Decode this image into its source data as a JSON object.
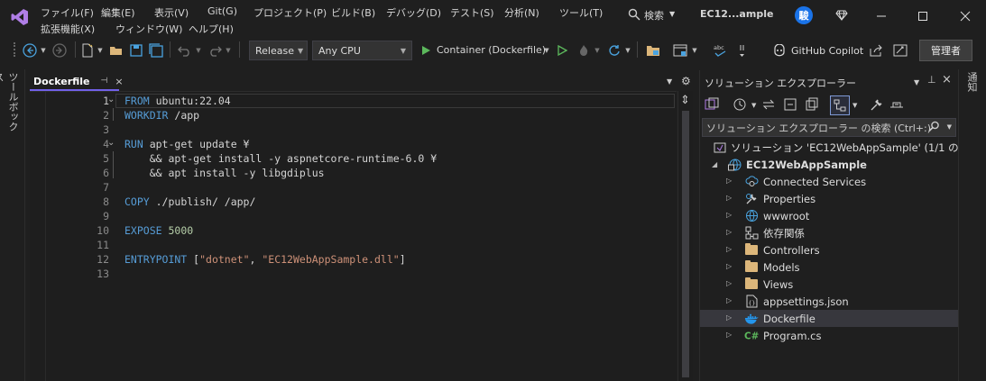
{
  "title_bar": {
    "menu": [
      "ファイル(F)",
      "編集(E)",
      "表示(V)",
      "Git(G)",
      "プロジェクト(P)",
      "ビルド(B)",
      "デバッグ(D)",
      "テスト(S)",
      "分析(N)",
      "ツール(T)"
    ],
    "menu_row2": [
      "拡張機能(X)",
      "ウィンドウ(W)",
      "ヘルプ(H)"
    ],
    "search_label": "検索",
    "window_title": "EC12...ample",
    "avatar_text": "駿"
  },
  "toolbar": {
    "configuration": "Release",
    "platform": "Any CPU",
    "run_target": "Container (Dockerfile)",
    "copilot_label": "GitHub Copilot",
    "admin_label": "管理者"
  },
  "left_rail": {
    "toolbox_label": "ツールボックス"
  },
  "right_rail": {
    "label": "通知"
  },
  "editor": {
    "tab_title": "Dockerfile",
    "line_numbers": [
      "1",
      "2",
      "3",
      "4",
      "5",
      "6",
      "7",
      "8",
      "9",
      "10",
      "11",
      "12",
      "13"
    ],
    "lines": [
      [
        {
          "t": "FROM",
          "c": "kw"
        },
        {
          "t": " ubuntu:22.04",
          "c": "tx"
        }
      ],
      [
        {
          "t": "WORKDIR",
          "c": "kw"
        },
        {
          "t": " /app",
          "c": "tx"
        }
      ],
      [],
      [
        {
          "t": "RUN",
          "c": "kw"
        },
        {
          "t": " apt-get update ¥",
          "c": "tx"
        }
      ],
      [
        {
          "t": "    && apt-get install -y aspnetcore-runtime-6.0 ¥",
          "c": "tx"
        }
      ],
      [
        {
          "t": "    && apt install -y libgdiplus",
          "c": "tx"
        }
      ],
      [],
      [
        {
          "t": "COPY",
          "c": "kw"
        },
        {
          "t": " ./publish/ /app/",
          "c": "tx"
        }
      ],
      [],
      [
        {
          "t": "EXPOSE",
          "c": "kw"
        },
        {
          "t": " ",
          "c": "tx"
        },
        {
          "t": "5000",
          "c": "num"
        }
      ],
      [],
      [
        {
          "t": "ENTRYPOINT",
          "c": "kw"
        },
        {
          "t": " [",
          "c": "tx"
        },
        {
          "t": "\"dotnet\"",
          "c": "str"
        },
        {
          "t": ", ",
          "c": "tx"
        },
        {
          "t": "\"EC12WebAppSample.dll\"",
          "c": "str"
        },
        {
          "t": "]",
          "c": "tx"
        }
      ],
      []
    ]
  },
  "solution_explorer": {
    "title": "ソリューション エクスプローラー",
    "search_placeholder": "ソリューション エクスプローラー の検索 (Ctrl+:)",
    "solution_label": "ソリューション 'EC12WebAppSample' (1/1 のプロジェ",
    "project_label": "EC12WebAppSample",
    "items": [
      {
        "label": "Connected Services",
        "icon": "connected-services-icon"
      },
      {
        "label": "Properties",
        "icon": "wrench-icon"
      },
      {
        "label": "wwwroot",
        "icon": "globe-icon"
      },
      {
        "label": "依存関係",
        "icon": "dependencies-icon"
      },
      {
        "label": "Controllers",
        "icon": "folder-icon"
      },
      {
        "label": "Models",
        "icon": "folder-icon"
      },
      {
        "label": "Views",
        "icon": "folder-icon"
      },
      {
        "label": "appsettings.json",
        "icon": "json-file-icon"
      },
      {
        "label": "Dockerfile",
        "icon": "docker-icon",
        "selected": true
      },
      {
        "label": "Program.cs",
        "icon": "csharp-file-icon"
      }
    ]
  },
  "colors": {
    "accent": "#7f6ad6",
    "selected_row": "#37373d",
    "tab_underline": "#7160e8",
    "run_green": "#5cb85c"
  }
}
